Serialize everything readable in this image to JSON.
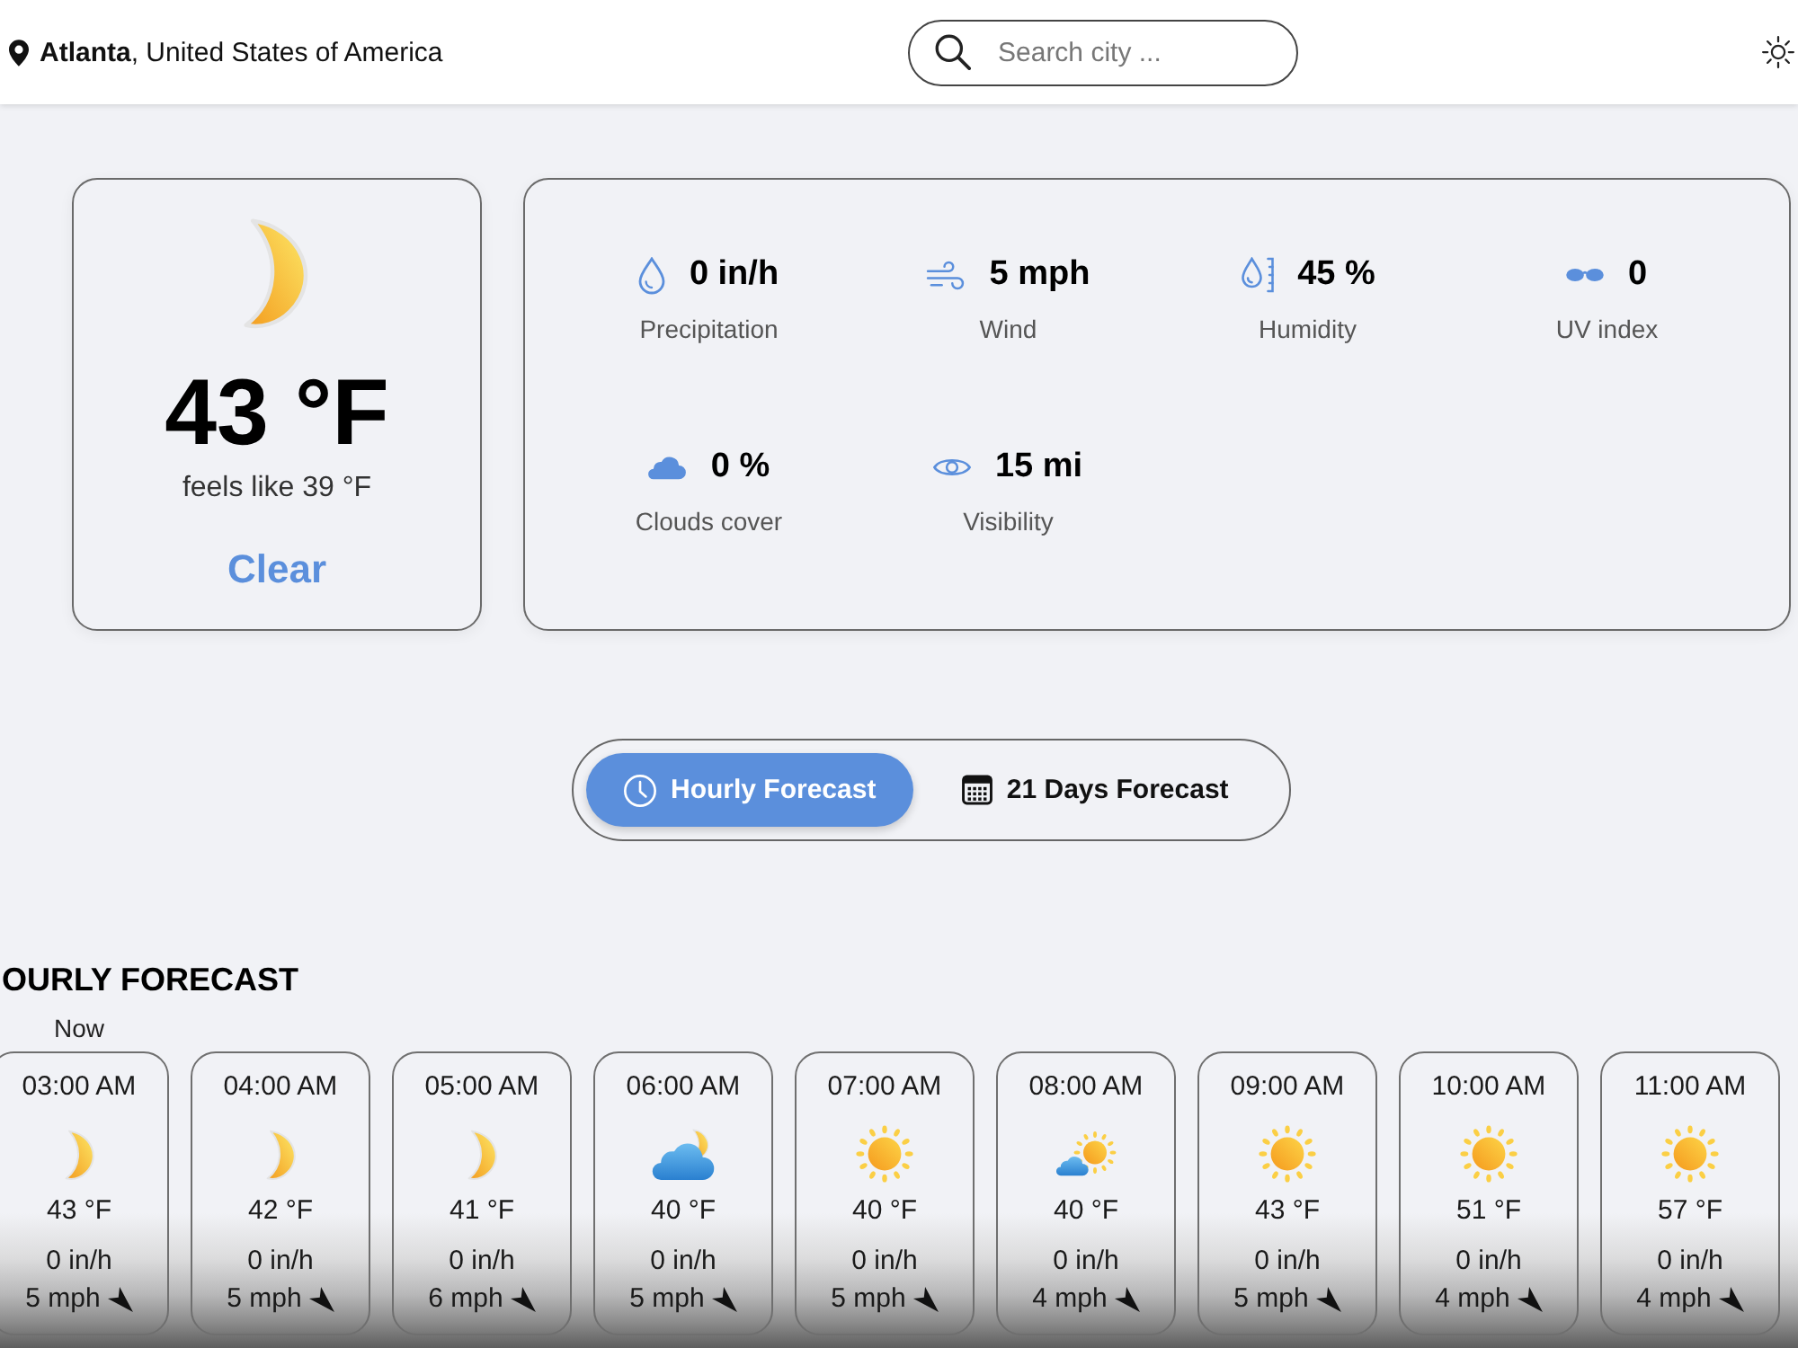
{
  "header": {
    "location": "**Atlanta**, United States of America",
    "search": {
      "placeholder": "Search city ..."
    }
  },
  "current": {
    "kind": "clear-night",
    "temperature": "43 °F",
    "feels_like": "feels like 39 °F",
    "condition": "Clear"
  },
  "details": [
    {
      "kind": "precipitation",
      "value": "0 in/h",
      "label": "Precipitation"
    },
    {
      "kind": "wind",
      "value": "5 mph",
      "label": "Wind"
    },
    {
      "kind": "humidity",
      "value": "45 %",
      "label": "Humidity"
    },
    {
      "kind": "uv",
      "value": "0",
      "label": "UV index"
    },
    {
      "kind": "clouds",
      "value": "0 %",
      "label": "Clouds cover"
    },
    {
      "kind": "visibility",
      "value": "15 mi",
      "label": "Visibility"
    }
  ],
  "forecast_tabs": [
    {
      "kind": "clock",
      "label": "Hourly Forecast",
      "selected": true
    },
    {
      "kind": "calendar",
      "label": "21 Days Forecast",
      "selected": false
    }
  ],
  "hourly": {
    "title": "OURLY FORECAST",
    "items": [
      {
        "tag": "Now",
        "time": "03:00 AM",
        "kind": "clear-night",
        "temperature": "43 °F",
        "precipitation": "0 in/h",
        "wind": "5 mph"
      },
      {
        "time": "04:00 AM",
        "kind": "clear-night",
        "temperature": "42 °F",
        "precipitation": "0 in/h",
        "wind": "5 mph"
      },
      {
        "time": "05:00 AM",
        "kind": "clear-night",
        "temperature": "41 °F",
        "precipitation": "0 in/h",
        "wind": "6 mph"
      },
      {
        "time": "06:00 AM",
        "kind": "cloudy-night",
        "temperature": "40 °F",
        "precipitation": "0 in/h",
        "wind": "5 mph"
      },
      {
        "time": "07:00 AM",
        "kind": "sunny",
        "temperature": "40 °F",
        "precipitation": "0 in/h",
        "wind": "5 mph"
      },
      {
        "time": "08:00 AM",
        "kind": "partly-cloudy",
        "temperature": "40 °F",
        "precipitation": "0 in/h",
        "wind": "4 mph"
      },
      {
        "time": "09:00 AM",
        "kind": "sunny",
        "temperature": "43 °F",
        "precipitation": "0 in/h",
        "wind": "5 mph"
      },
      {
        "time": "10:00 AM",
        "kind": "sunny",
        "temperature": "51 °F",
        "precipitation": "0 in/h",
        "wind": "4 mph"
      },
      {
        "time": "11:00 AM",
        "kind": "sunny",
        "temperature": "57 °F",
        "precipitation": "0 in/h",
        "wind": "4 mph"
      }
    ]
  }
}
